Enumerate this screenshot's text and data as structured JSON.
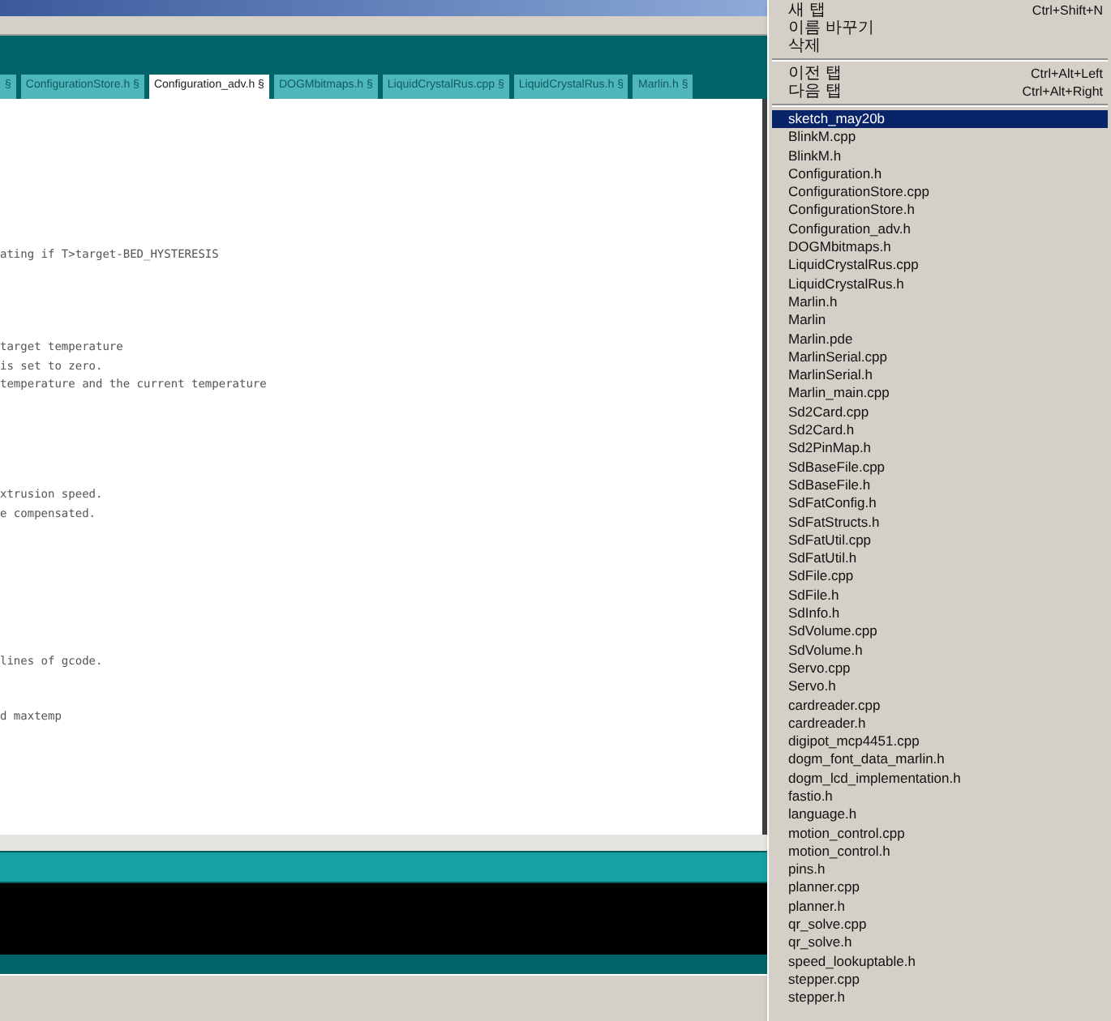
{
  "editor_tabs": [
    {
      "label": "§",
      "selected": false
    },
    {
      "label": "ConfigurationStore.h §",
      "selected": false
    },
    {
      "label": "Configuration_adv.h §",
      "selected": true
    },
    {
      "label": "DOGMbitmaps.h §",
      "selected": false
    },
    {
      "label": "LiquidCrystalRus.cpp §",
      "selected": false
    },
    {
      "label": "LiquidCrystalRus.h §",
      "selected": false
    },
    {
      "label": "Marlin.h §",
      "selected": false
    }
  ],
  "code_lines": [
    "ating if T>target-BED_HYSTERESIS",
    "target temperature",
    "is set to zero.",
    "temperature and the current temperature",
    "xtrusion speed.",
    "e compensated.",
    "lines of gcode.",
    "d maxtemp"
  ],
  "menu": {
    "commands": [
      {
        "kind": "item",
        "label": "새 탭",
        "shortcut": "Ctrl+Shift+N"
      },
      {
        "kind": "item",
        "label": "이름 바꾸기"
      },
      {
        "kind": "item",
        "label": "삭제"
      },
      {
        "kind": "separator"
      },
      {
        "kind": "item",
        "label": "이전 탭",
        "shortcut": "Ctrl+Alt+Left"
      },
      {
        "kind": "item",
        "label": "다음 탭",
        "shortcut": "Ctrl+Alt+Right"
      },
      {
        "kind": "separator"
      }
    ],
    "files": [
      {
        "label": "sketch_may20b",
        "selected": true
      },
      {
        "label": "BlinkM.cpp",
        "selected": false
      },
      {
        "label": "BlinkM.h",
        "selected": false
      },
      {
        "label": "Configuration.h",
        "selected": false
      },
      {
        "label": "ConfigurationStore.cpp",
        "selected": false
      },
      {
        "label": "ConfigurationStore.h",
        "selected": false
      },
      {
        "label": "Configuration_adv.h",
        "selected": false
      },
      {
        "label": "DOGMbitmaps.h",
        "selected": false
      },
      {
        "label": "LiquidCrystalRus.cpp",
        "selected": false
      },
      {
        "label": "LiquidCrystalRus.h",
        "selected": false
      },
      {
        "label": "Marlin.h",
        "selected": false
      },
      {
        "label": "Marlin",
        "selected": false
      },
      {
        "label": "Marlin.pde",
        "selected": false
      },
      {
        "label": "MarlinSerial.cpp",
        "selected": false
      },
      {
        "label": "MarlinSerial.h",
        "selected": false
      },
      {
        "label": "Marlin_main.cpp",
        "selected": false
      },
      {
        "label": "Sd2Card.cpp",
        "selected": false
      },
      {
        "label": "Sd2Card.h",
        "selected": false
      },
      {
        "label": "Sd2PinMap.h",
        "selected": false
      },
      {
        "label": "SdBaseFile.cpp",
        "selected": false
      },
      {
        "label": "SdBaseFile.h",
        "selected": false
      },
      {
        "label": "SdFatConfig.h",
        "selected": false
      },
      {
        "label": "SdFatStructs.h",
        "selected": false
      },
      {
        "label": "SdFatUtil.cpp",
        "selected": false
      },
      {
        "label": "SdFatUtil.h",
        "selected": false
      },
      {
        "label": "SdFile.cpp",
        "selected": false
      },
      {
        "label": "SdFile.h",
        "selected": false
      },
      {
        "label": "SdInfo.h",
        "selected": false
      },
      {
        "label": "SdVolume.cpp",
        "selected": false
      },
      {
        "label": "SdVolume.h",
        "selected": false
      },
      {
        "label": "Servo.cpp",
        "selected": false
      },
      {
        "label": "Servo.h",
        "selected": false
      },
      {
        "label": "cardreader.cpp",
        "selected": false
      },
      {
        "label": "cardreader.h",
        "selected": false
      },
      {
        "label": "digipot_mcp4451.cpp",
        "selected": false
      },
      {
        "label": "dogm_font_data_marlin.h",
        "selected": false
      },
      {
        "label": "dogm_lcd_implementation.h",
        "selected": false
      },
      {
        "label": "fastio.h",
        "selected": false
      },
      {
        "label": "language.h",
        "selected": false
      },
      {
        "label": "motion_control.cpp",
        "selected": false
      },
      {
        "label": "motion_control.h",
        "selected": false
      },
      {
        "label": "pins.h",
        "selected": false
      },
      {
        "label": "planner.cpp",
        "selected": false
      },
      {
        "label": "planner.h",
        "selected": false
      },
      {
        "label": "qr_solve.cpp",
        "selected": false
      },
      {
        "label": "qr_solve.h",
        "selected": false
      },
      {
        "label": "speed_lookuptable.h",
        "selected": false
      },
      {
        "label": "stepper.cpp",
        "selected": false
      },
      {
        "label": "stepper.h",
        "selected": false
      }
    ]
  }
}
